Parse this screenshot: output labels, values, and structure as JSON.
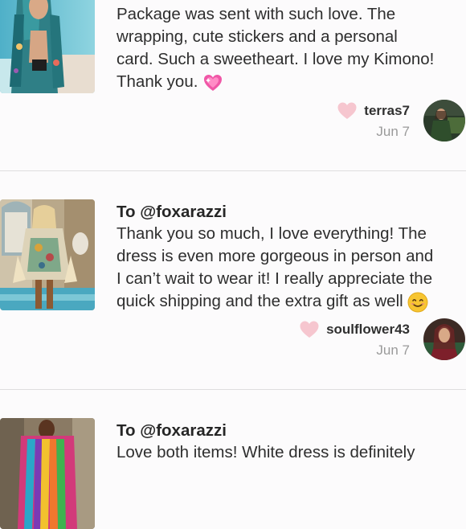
{
  "reviews": [
    {
      "lines": [
        "Package was sent with such love. The",
        "wrapping, cute stickers and a personal",
        "card. Such a sweetheart. I love my Kimono!",
        "Thank you."
      ],
      "end_emoji": "sparkling-heart-emoji",
      "username": "terras7",
      "date": "Jun 7"
    },
    {
      "recipient": "To @foxarazzi",
      "lines": [
        "Thank you so much, I love everything! The",
        "dress is even more gorgeous in person and",
        "I can’t wait to wear it! I really appreciate the",
        "quick shipping and the extra gift as well"
      ],
      "end_emoji": "smiling-face-emoji",
      "username": "soulflower43",
      "date": "Jun 7"
    },
    {
      "recipient": "To @foxarazzi",
      "lines": [
        "Love both items! White dress is definitely"
      ]
    }
  ],
  "colors": {
    "heart": "#f6c6cf",
    "divider": "#dedede",
    "date": "#9a9a9a",
    "background": "#fcfbfc"
  }
}
